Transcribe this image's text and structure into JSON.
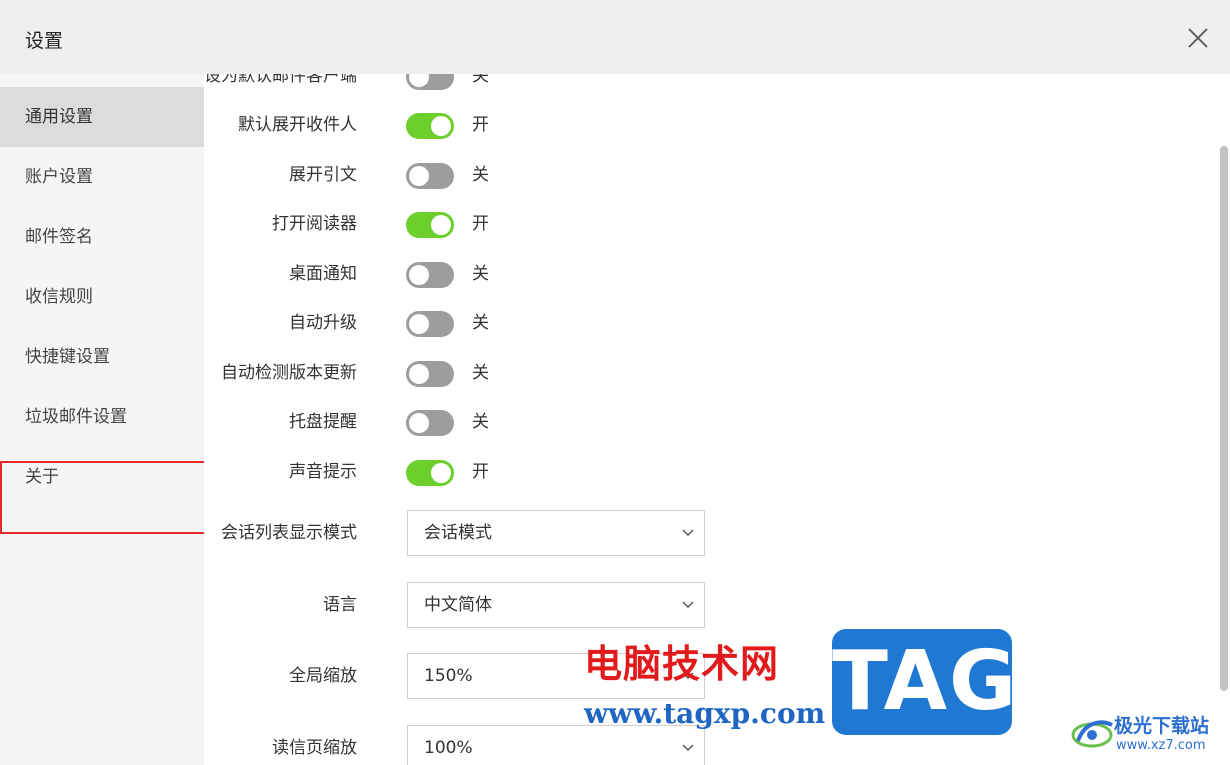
{
  "dialog": {
    "title": "设置"
  },
  "sidebar": {
    "items": [
      {
        "label": "通用设置",
        "active": true
      },
      {
        "label": "账户设置",
        "active": false
      },
      {
        "label": "邮件签名",
        "active": false
      },
      {
        "label": "收信规则",
        "active": false
      },
      {
        "label": "快捷键设置",
        "active": false
      },
      {
        "label": "垃圾邮件设置",
        "active": false
      },
      {
        "label": "关于",
        "active": false
      }
    ]
  },
  "settings": {
    "toggles": [
      {
        "label": "设为默认邮件客户端",
        "on": false,
        "state": "关"
      },
      {
        "label": "默认展开收件人",
        "on": true,
        "state": "开"
      },
      {
        "label": "展开引文",
        "on": false,
        "state": "关"
      },
      {
        "label": "打开阅读器",
        "on": true,
        "state": "开"
      },
      {
        "label": "桌面通知",
        "on": false,
        "state": "关"
      },
      {
        "label": "自动升级",
        "on": false,
        "state": "关"
      },
      {
        "label": "自动检测版本更新",
        "on": false,
        "state": "关"
      },
      {
        "label": "托盘提醒",
        "on": false,
        "state": "关"
      },
      {
        "label": "声音提示",
        "on": true,
        "state": "开"
      }
    ],
    "selects": [
      {
        "label": "会话列表显示模式",
        "value": "会话模式"
      },
      {
        "label": "语言",
        "value": "中文简体"
      },
      {
        "label": "全局缩放",
        "value": "150%"
      },
      {
        "label": "读信页缩放",
        "value": "100%"
      }
    ]
  },
  "watermark": {
    "site_name": "电脑技术网",
    "site_url": "www.tagxp.com",
    "logo_text": "TAG",
    "site2_name": "极光下载站",
    "site2_url": "www.xz7.com"
  },
  "colors": {
    "toggle_on": "#6ccf2b",
    "toggle_off": "#9d9d9d",
    "highlight_box": "#e32b2b",
    "sidebar_bg": "#f5f5f5",
    "sidebar_active_bg": "#dcdcdc",
    "titlebar_bg": "#efefef",
    "watermark_red": "#e11b1b",
    "watermark_blue": "#1f78d1"
  }
}
